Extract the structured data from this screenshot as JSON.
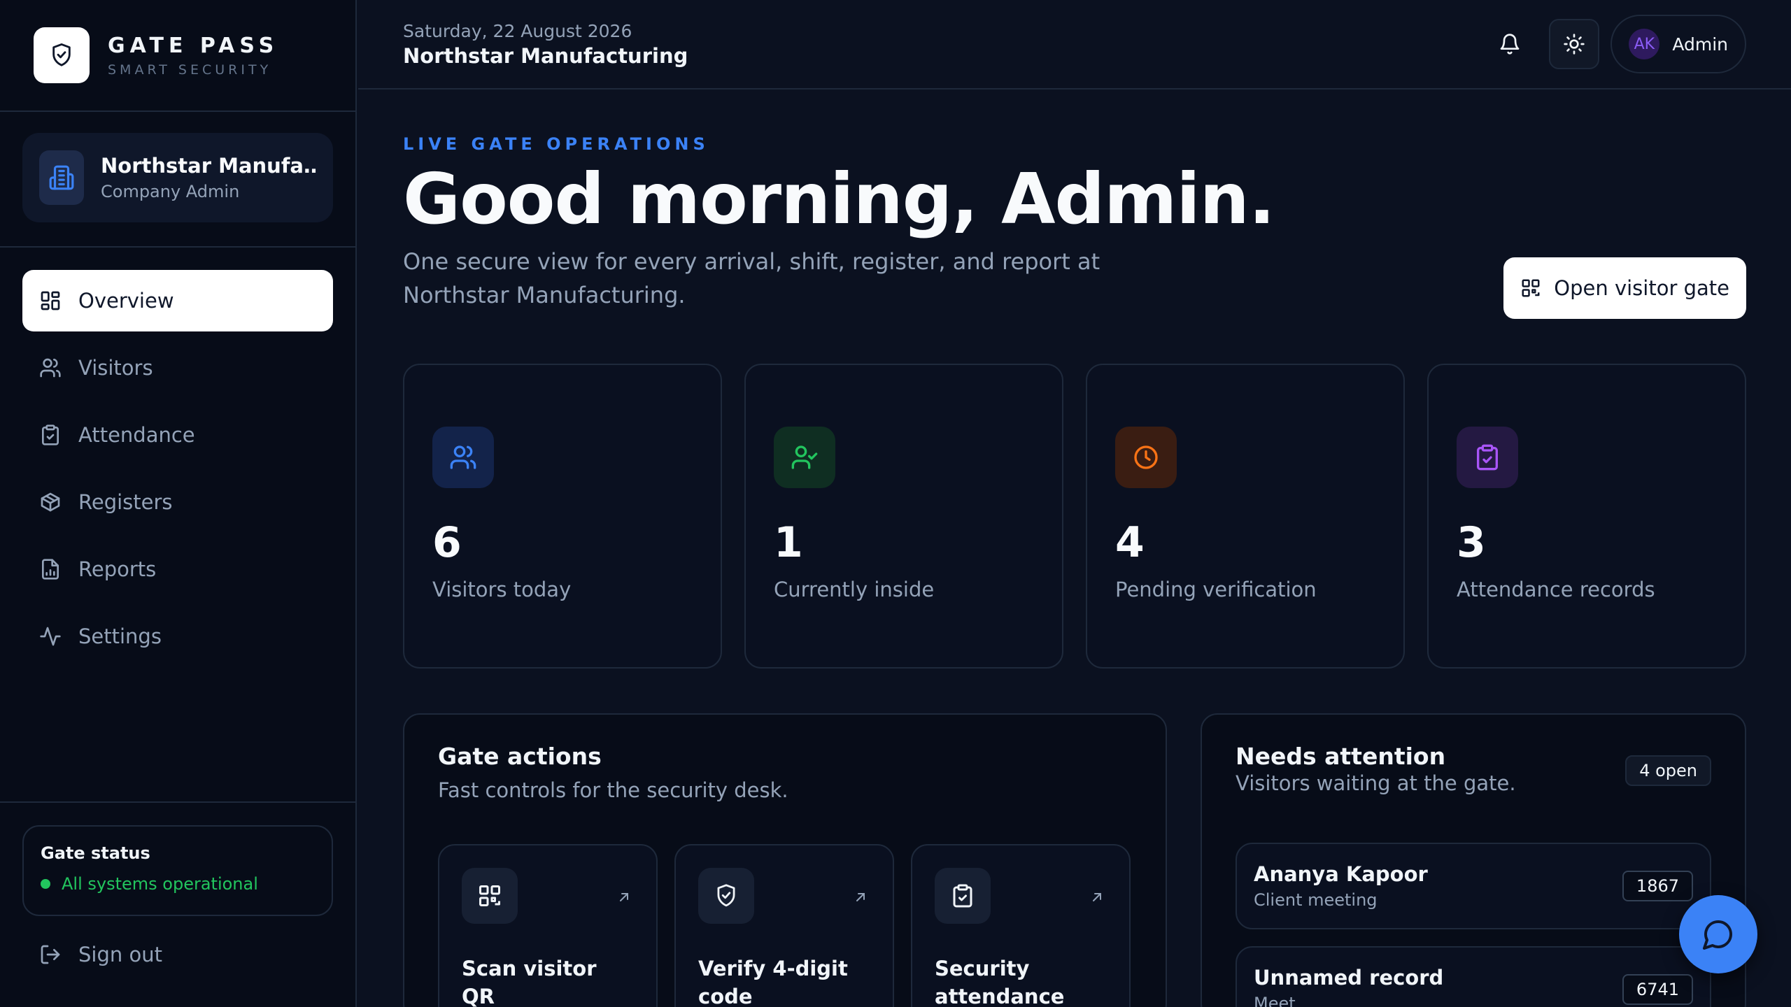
{
  "brand": {
    "name": "GATE PASS",
    "tagline": "SMART SECURITY"
  },
  "organization": {
    "name": "Northstar Manufacturing",
    "role": "Company Admin"
  },
  "nav": {
    "items": [
      {
        "label": "Overview",
        "icon": "grid-icon",
        "active": true
      },
      {
        "label": "Visitors",
        "icon": "users-icon"
      },
      {
        "label": "Attendance",
        "icon": "clipboard-check-icon"
      },
      {
        "label": "Registers",
        "icon": "package-icon"
      },
      {
        "label": "Reports",
        "icon": "report-icon"
      },
      {
        "label": "Settings",
        "icon": "activity-icon"
      }
    ]
  },
  "gate_status": {
    "title": "Gate status",
    "message": "All systems operational",
    "color": "#22c55e"
  },
  "sign_out": "Sign out",
  "topbar": {
    "date": "Saturday, 22 August 2026",
    "org": "Northstar Manufacturing",
    "user_initials": "AK",
    "user_name": "Admin"
  },
  "hero": {
    "eyebrow": "LIVE GATE OPERATIONS",
    "headline": "Good morning, Admin.",
    "subline": "One secure view for every arrival, shift, register, and report at Northstar Manufacturing.",
    "cta": "Open visitor gate"
  },
  "stats": [
    {
      "value": "6",
      "label": "Visitors today",
      "icon": "users-icon",
      "color": "#3b82f6"
    },
    {
      "value": "1",
      "label": "Currently inside",
      "icon": "user-check-icon",
      "color": "#22c55e"
    },
    {
      "value": "4",
      "label": "Pending verification",
      "icon": "clock-icon",
      "color": "#f97316"
    },
    {
      "value": "3",
      "label": "Attendance records",
      "icon": "clipboard-check-icon",
      "color": "#a855f7"
    }
  ],
  "gate_actions": {
    "title": "Gate actions",
    "subtitle": "Fast controls for the security desk.",
    "items": [
      {
        "label": "Scan visitor QR",
        "icon": "qr-code-icon"
      },
      {
        "label": "Verify 4-digit code",
        "icon": "shield-check-icon"
      },
      {
        "label": "Security attendance",
        "icon": "clipboard-check-icon"
      }
    ]
  },
  "needs_attention": {
    "title": "Needs attention",
    "subtitle": "Visitors waiting at the gate.",
    "badge": "4 open",
    "visitors": [
      {
        "name": "Ananya Kapoor",
        "purpose": "Client meeting",
        "code": "1867"
      },
      {
        "name": "Unnamed record",
        "purpose": "Meet",
        "code": "6741"
      }
    ]
  },
  "colors": {
    "accent": "#3b82f6",
    "background": "#0b1120",
    "success": "#22c55e"
  }
}
